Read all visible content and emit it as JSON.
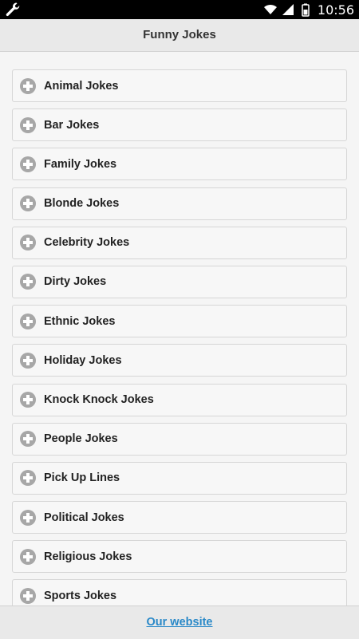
{
  "status_bar": {
    "time": "10:56",
    "left_icon": "wrench-icon",
    "icons": [
      "wifi-icon",
      "signal-icon",
      "battery-icon"
    ]
  },
  "header": {
    "title": "Funny Jokes"
  },
  "categories": [
    {
      "label": "Animal Jokes",
      "icon": "plus-circle-icon"
    },
    {
      "label": "Bar Jokes",
      "icon": "plus-circle-icon"
    },
    {
      "label": "Family Jokes",
      "icon": "plus-circle-icon"
    },
    {
      "label": "Blonde Jokes",
      "icon": "plus-circle-icon"
    },
    {
      "label": "Celebrity Jokes",
      "icon": "plus-circle-icon"
    },
    {
      "label": "Dirty Jokes",
      "icon": "plus-circle-icon"
    },
    {
      "label": "Ethnic Jokes",
      "icon": "plus-circle-icon"
    },
    {
      "label": "Holiday Jokes",
      "icon": "plus-circle-icon"
    },
    {
      "label": "Knock Knock Jokes",
      "icon": "plus-circle-icon"
    },
    {
      "label": "People Jokes",
      "icon": "plus-circle-icon"
    },
    {
      "label": "Pick Up Lines",
      "icon": "plus-circle-icon"
    },
    {
      "label": "Political Jokes",
      "icon": "plus-circle-icon"
    },
    {
      "label": "Religious Jokes",
      "icon": "plus-circle-icon"
    },
    {
      "label": "Sports Jokes",
      "icon": "plus-circle-icon"
    }
  ],
  "footer": {
    "link_label": "Our website"
  },
  "colors": {
    "link": "#2a89c8",
    "plus_icon": "#a7a7a7",
    "header_bg": "#e9e9e9"
  }
}
